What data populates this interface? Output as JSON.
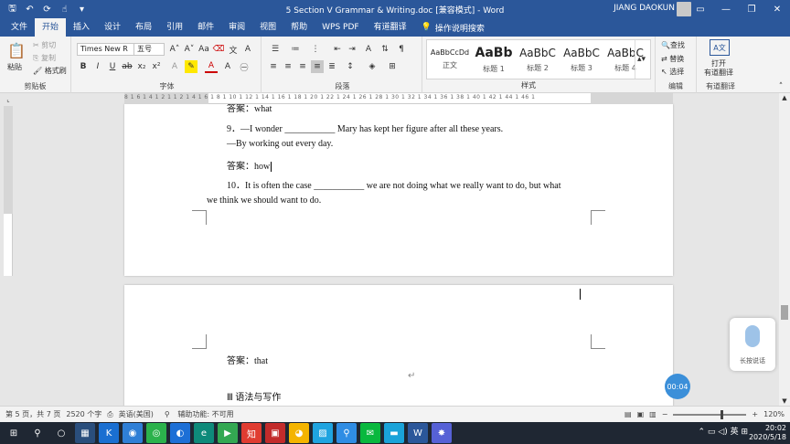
{
  "window": {
    "title": "5 Section V   Grammar & Writing.doc [兼容模式] - Word",
    "user": "JIANG DAOKUN"
  },
  "tabs": [
    "文件",
    "开始",
    "插入",
    "设计",
    "布局",
    "引用",
    "邮件",
    "审阅",
    "视图",
    "帮助",
    "WPS PDF",
    "有道翻译"
  ],
  "active_tab": "开始",
  "tell_me": "操作说明搜索",
  "clipboard": {
    "paste": "粘贴",
    "cut": "剪切",
    "copy": "复制",
    "format_painter": "格式刷",
    "label": "剪贴板"
  },
  "font": {
    "name": "Times New R",
    "size": "五号",
    "label": "字体"
  },
  "paragraph": {
    "label": "段落"
  },
  "styles": {
    "label": "样式",
    "items": [
      {
        "sample": "AaBbCcDd",
        "name": "正文"
      },
      {
        "sample": "AaBb",
        "name": "标题 1"
      },
      {
        "sample": "AaBbC",
        "name": "标题 2"
      },
      {
        "sample": "AaBbC",
        "name": "标题 3"
      },
      {
        "sample": "AaBbC",
        "name": "标题 4"
      }
    ]
  },
  "editing": {
    "find": "查找",
    "replace": "替换",
    "select": "选择",
    "label": "编辑"
  },
  "youdao": {
    "open": "打开",
    "translate": "有道翻译",
    "label": "有道翻译"
  },
  "ruler": {
    "marks": "8 1 6 1 4 1 2 1 1 2 1 4 1 6 1 8 1 10 1 12 1 14 1 16 1 18 1 20 1 22 1 24 1 26 1 28 1 30 1 32 1 34 1 36 1 38 1 40 1 42 1 44 1 46 1"
  },
  "document": {
    "page1": {
      "cutoff": "答案：what",
      "q9": "9．—I wonder ___________ Mary has kept her figure after all these years.",
      "q9_reply": "—By working out every day.",
      "answer_label": "答案：",
      "answer_value": "how",
      "q10_line1": "10．It is often the case ___________ we are not doing what we really want to do, but what",
      "q10_line2": "we think we should want to do."
    },
    "page2": {
      "answer": "答案：that",
      "section": "Ⅲ  语法与写作"
    }
  },
  "voice_widget": {
    "label": "长按说话"
  },
  "timer": "00:04",
  "status": {
    "page": "第 5 页，共 7 页",
    "words": "2520 个字",
    "language": "英语(美国)",
    "accessibility": "辅助功能: 不可用",
    "zoom": "120%"
  },
  "taskbar": {
    "time": "20:02",
    "date": "2020/5/18",
    "ime": "英"
  }
}
